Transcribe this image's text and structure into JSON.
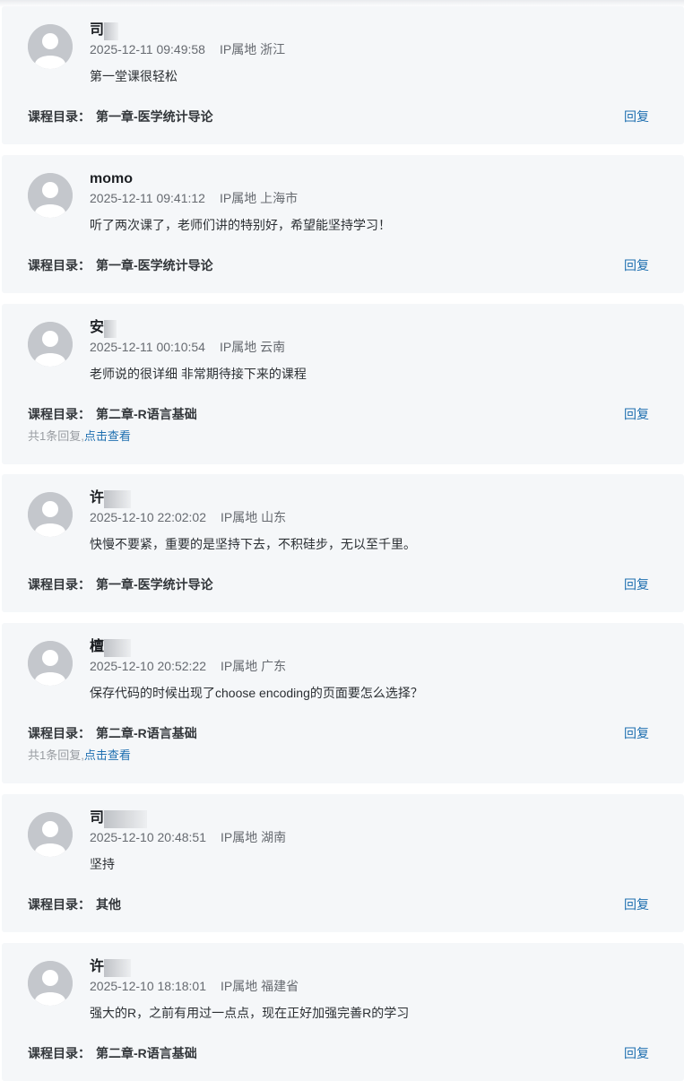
{
  "labels": {
    "catalog_label": "课程目录：",
    "reply": "回复"
  },
  "comments": [
    {
      "name": "司",
      "time": "2025-12-11 09:49:58",
      "ip": "IP属地 浙江",
      "content": "第一堂课很轻松",
      "chapter": "第一章-医学统计导论"
    },
    {
      "name": "momo",
      "time": "2025-12-11 09:41:12",
      "ip": "IP属地 上海市",
      "content": "听了两次课了，老师们讲的特别好，希望能坚持学习！",
      "chapter": "第一章-医学统计导论"
    },
    {
      "name": "安",
      "time": "2025-12-11 00:10:54",
      "ip": "IP属地 云南",
      "content": "老师说的很详细 非常期待接下来的课程",
      "chapter": "第二章-R语言基础",
      "replies_text": "共1条回复,",
      "view_text": "点击查看"
    },
    {
      "name": "许",
      "time": "2025-12-10 22:02:02",
      "ip": "IP属地 山东",
      "content": "快慢不要紧，重要的是坚持下去，不积硅步，无以至千里。",
      "chapter": "第一章-医学统计导论"
    },
    {
      "name": "檀",
      "time": "2025-12-10 20:52:22",
      "ip": "IP属地 广东",
      "content": "保存代码的时候出现了choose encoding的页面要怎么选择？",
      "chapter": "第二章-R语言基础",
      "replies_text": "共1条回复,",
      "view_text": "点击查看"
    },
    {
      "name": "司",
      "time": "2025-12-10 20:48:51",
      "ip": "IP属地 湖南",
      "content": "坚持",
      "chapter": "其他"
    },
    {
      "name": "许",
      "time": "2025-12-10 18:18:01",
      "ip": "IP属地 福建省",
      "content": "强大的R，之前有用过一点点，现在正好加强完善R的学习",
      "chapter": "第二章-R语言基础"
    }
  ]
}
